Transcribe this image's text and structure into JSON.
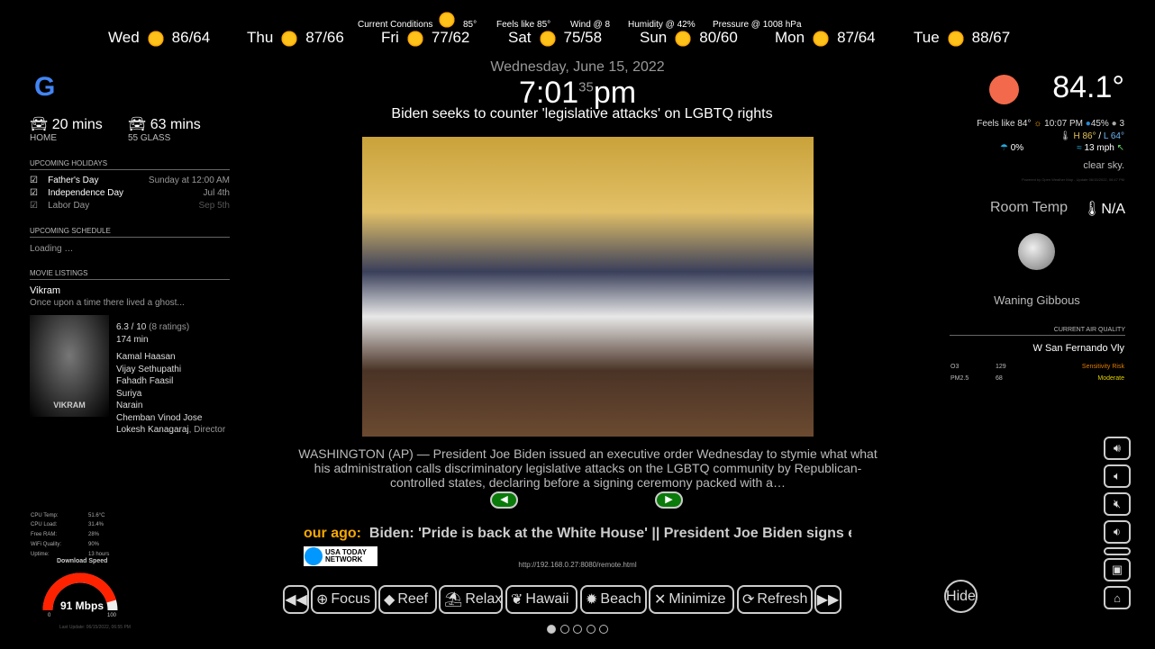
{
  "forecast": [
    {
      "day": "Wed",
      "icon": "sun-icon",
      "temp": "86/64"
    },
    {
      "day": "Thu",
      "icon": "sun-icon",
      "temp": "87/66"
    },
    {
      "day": "Fri",
      "icon": "sun-icon",
      "temp": "77/62"
    },
    {
      "day": "Sat",
      "icon": "sun-icon",
      "temp": "75/58"
    },
    {
      "day": "Sun",
      "icon": "sun-icon",
      "temp": "80/60"
    },
    {
      "day": "Mon",
      "icon": "sun-icon",
      "temp": "87/64"
    },
    {
      "day": "Tue",
      "icon": "sun-icon",
      "temp": "88/67"
    }
  ],
  "current_conditions": {
    "label": "Current Conditions",
    "temp": "85°",
    "feels": "Feels like 85°",
    "wind": "Wind @ 8",
    "humidity": "Humidity @ 42%",
    "pressure": "Pressure @ 1008 hPa"
  },
  "clock": {
    "date": "Wednesday, June 15, 2022",
    "time": "7:01",
    "seconds": "35",
    "ampm": "pm"
  },
  "news": {
    "headline": "Biden seeks to counter 'legislative attacks' on LGBTQ rights",
    "description": "WASHINGTON (AP) — President Joe Biden issued an executive order Wednesday to stymie what what his administration calls discriminatory legislative attacks on the LGBTQ community by Republican-controlled states, declaring before a signing ceremony packed with a…",
    "ticker_prefix": "our ago:",
    "ticker": "Biden: 'Pride is back at the White House'  ||  President Joe Biden signs executive o",
    "source_logo": "USA TODAY NETWORK",
    "url": "http://192.168.0.27:8080/remote.html"
  },
  "commute": [
    {
      "time": "20 mins",
      "label": "HOME"
    },
    {
      "time": "63 mins",
      "label": "55 GLASS"
    }
  ],
  "holidays": {
    "title": "UPCOMING HOLIDAYS",
    "items": [
      {
        "name": "Father's Day",
        "when": "Sunday at 12:00 AM"
      },
      {
        "name": "Independence Day",
        "when": "Jul 4th"
      },
      {
        "name": "Labor Day",
        "when": "Sep 5th"
      }
    ]
  },
  "schedule": {
    "title": "UPCOMING SCHEDULE",
    "text": "Loading …"
  },
  "movies": {
    "title": "MOVIE LISTINGS",
    "name": "Vikram",
    "tagline": "Once upon a time there lived a ghost...",
    "rating": "6.3 / 10",
    "ratings_count": "(8 ratings)",
    "runtime": "174 min",
    "cast": [
      "Kamal Haasan",
      "Vijay Sethupathi",
      "Fahadh Faasil",
      "Suriya",
      "Narain",
      "Chemban Vinod Jose"
    ],
    "director": "Lokesh Kanagaraj",
    "director_label": ", Director",
    "poster_text": "VIKRAM"
  },
  "system": [
    {
      "k": "CPU Temp:",
      "v": "51.6°C"
    },
    {
      "k": "CPU Load:",
      "v": "31.4%"
    },
    {
      "k": "Free RAM:",
      "v": "28%"
    },
    {
      "k": "WiFi Quality:",
      "v": "90%"
    },
    {
      "k": "Uptime:",
      "v": "13 hours"
    }
  ],
  "speed": {
    "title": "Download Speed",
    "value": "91 Mbps",
    "fraction": 0.91,
    "min": "0",
    "max": "100",
    "updated": "Last Update: 06/15/2022, 06:55 PM"
  },
  "weather": {
    "temp": "84.1°",
    "feels": "Feels like 84°",
    "sunset": "10:07 PM",
    "humidity": "45%",
    "uv": "3",
    "high": "H 86°",
    "low": "L 64°",
    "precip": "0%",
    "wind": "13 mph",
    "desc": "clear sky.",
    "powered": "Powered by Open Weather Map - Update 06/15/2022, 06:47 PM"
  },
  "room": {
    "label": "Room Temp",
    "value": "N/A"
  },
  "moon": {
    "phase": "Waning Gibbous"
  },
  "air": {
    "title": "CURRENT AIR QUALITY",
    "location": "W San Fernando Vly",
    "rows": [
      {
        "k": "O3",
        "v": "129",
        "s": "Sensitivity Risk",
        "color": "#e07b00"
      },
      {
        "k": "PM2.5",
        "v": "68",
        "s": "Moderate",
        "color": "#e0d000"
      }
    ]
  },
  "buttons": {
    "focus": "Focus",
    "reef": "Reef",
    "relax": "Relax",
    "hawaii": "Hawaii",
    "beach": "Beach",
    "minimize": "Minimize",
    "refresh": "Refresh",
    "hide": "Hide"
  }
}
